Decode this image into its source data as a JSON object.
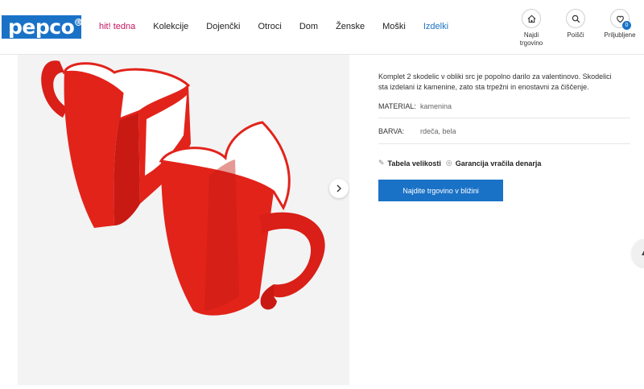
{
  "header": {
    "logo": "pepco",
    "nav": [
      "hit! tedna",
      "Kolekcije",
      "Dojenčki",
      "Otroci",
      "Dom",
      "Ženske",
      "Moški",
      "Izdelki"
    ],
    "icons": [
      {
        "label1": "Najdi",
        "label2": "trgovino",
        "icon": "home-icon"
      },
      {
        "label1": "Poišči",
        "icon": "search-icon"
      },
      {
        "label1": "Priljubljene",
        "icon": "heart-icon",
        "badge": "0"
      }
    ]
  },
  "product": {
    "description": "Komplet 2 skodelic v obliki src je popolno darilo za valentinovo. Skodelici sta izdelani iz kamenine, zato sta trpežni in enostavni za čiščenje.",
    "attributes": [
      {
        "key": "MATERIAL:",
        "value": "kamenina"
      },
      {
        "key": "BARVA:",
        "value": "rdeča, bela"
      }
    ],
    "links": [
      "Tabela velikosti",
      "Garancija vračila denarja"
    ],
    "cta": "Najdite trgovino v bližini"
  },
  "colors": {
    "brand": "#1a72c7",
    "hot": "#c4145f",
    "mug_red": "#e2231a"
  }
}
